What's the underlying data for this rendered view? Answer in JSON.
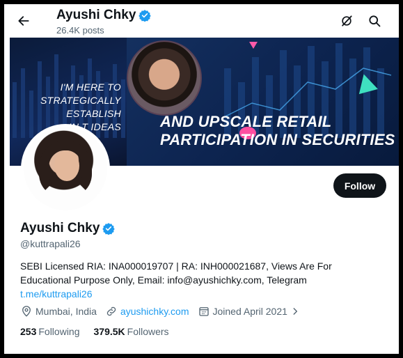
{
  "header": {
    "name": "Ayushi Chky",
    "posts": "26.4K posts"
  },
  "banner": {
    "text_left": [
      "I'M HERE TO",
      "STRATEGICALLY",
      "ESTABLISH",
      "IN      T IDEAS"
    ],
    "text_right": [
      "AND UPSCALE RETAIL",
      "PARTICIPATION IN SECURITIES"
    ]
  },
  "profile": {
    "follow_label": "Follow",
    "name": "Ayushi Chky",
    "handle": "@kuttrapali26",
    "bio_text": "SEBI Licensed RIA: INA000019707 | RA: INH000021687, Views Are For Educational Purpose Only, Email: info@ayushichky.com, Telegram",
    "bio_link": "t.me/kuttrapali26",
    "location": "Mumbai, India",
    "website": "ayushichky.com",
    "joined": "Joined April 2021",
    "following_count": "253",
    "following_label": "Following",
    "followers_count": "379.5K",
    "followers_label": "Followers"
  },
  "colors": {
    "accent": "#1d9bf0",
    "verified": "#1d9bf0",
    "text": "#0f1419",
    "muted": "#536471"
  },
  "icons": [
    "back-arrow-icon",
    "grok-icon",
    "search-icon",
    "verified-badge-icon",
    "location-icon",
    "link-icon",
    "calendar-icon",
    "chevron-right-icon"
  ]
}
